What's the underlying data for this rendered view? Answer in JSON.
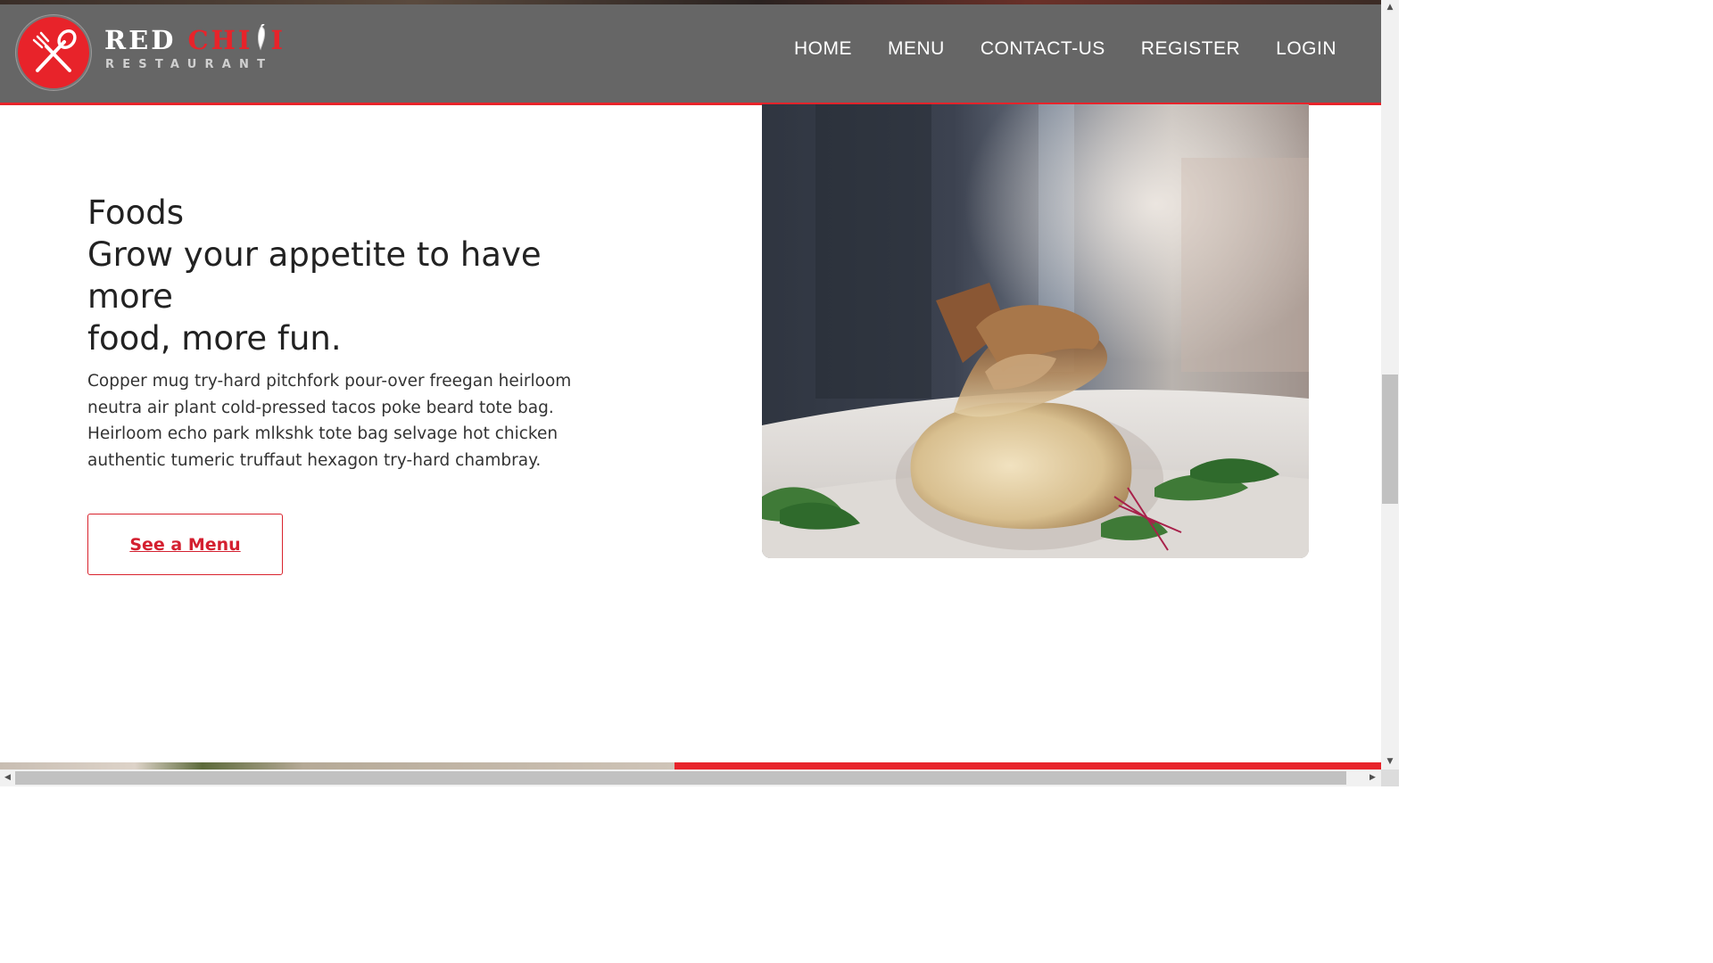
{
  "brand": {
    "name_part1": "RED ",
    "name_part2": "CHI",
    "name_part3": "I",
    "name_icon": "chili-pepper-icon",
    "tagline": "RESTAURANT",
    "logo_icon": "crossed-fork-spoon-icon",
    "accent_color": "#e8232a"
  },
  "nav": {
    "items": [
      {
        "label": "HOME"
      },
      {
        "label": "MENU"
      },
      {
        "label": "CONTACT-US"
      },
      {
        "label": "REGISTER"
      },
      {
        "label": "LOGIN"
      }
    ],
    "background_color": "#666666"
  },
  "hero": {
    "title_lines": [
      "Foods",
      "Grow your appetite to have",
      "more",
      "food, more fun."
    ],
    "description": "Copper mug try-hard pitchfork pour-over freegan heirloom neutra air plant cold-pressed tacos poke beard tote bag. Heirloom echo park mlkshk tote bag selvage hot chicken authentic tumeric truffaut hexagon try-hard chambray.",
    "cta_label": "See a Menu"
  },
  "scrollbars": {
    "up_arrow": "▲",
    "down_arrow": "▼",
    "left_arrow": "◀",
    "right_arrow": "▶"
  }
}
